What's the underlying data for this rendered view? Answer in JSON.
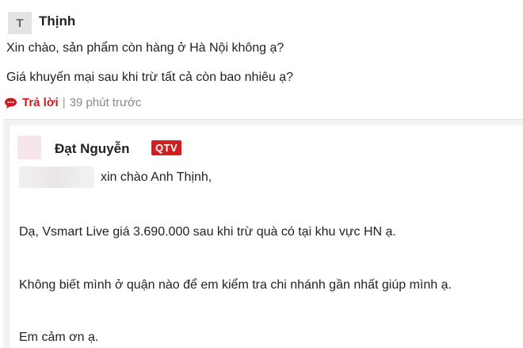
{
  "comment": {
    "avatar_letter": "T",
    "author": "Thịnh",
    "lines": [
      "Xin chào, sản phẩm còn hàng ở Hà Nội không ạ?",
      "Giá khuyến mại sau khi trừ tất cả còn bao nhiêu ạ?"
    ],
    "reply_label": "Trả lời",
    "separator": "|",
    "time": "39 phút trước",
    "reply_icon": "speech-bubble-icon"
  },
  "reply": {
    "author": "Đạt Nguyễn",
    "badge": "QTV",
    "lines": [
      "xin chào Anh Thịnh,",
      "Dạ, Vsmart Live giá 3.690.000 sau khi trừ quà có tại khu vực HN ạ.",
      "Không biết mình ở quận nào để em kiểm tra chi nhánh gần nhất giúp mình ạ.",
      "Em cảm ơn ạ."
    ]
  },
  "colors": {
    "accent_red": "#cc1d1d",
    "badge_red": "#d11f1f",
    "reply_bg": "#f2f2f2"
  }
}
